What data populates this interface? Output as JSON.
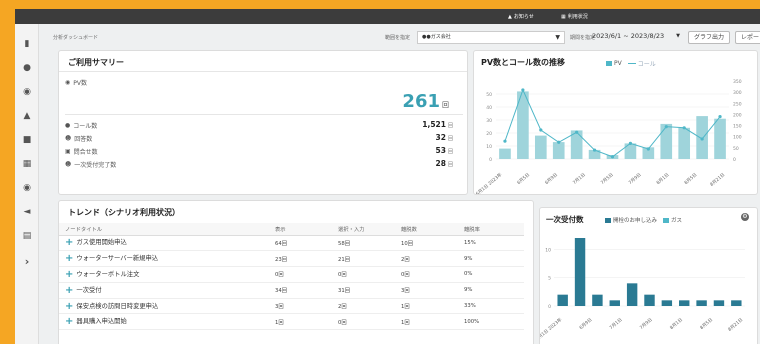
{
  "topbar": {
    "notice": "お知らせ",
    "usage": "利用状況"
  },
  "nav": [
    "analytics-icon",
    "chat-icon",
    "chat2-icon",
    "graduation-icon",
    "folder-icon",
    "calendar-icon",
    "location-icon",
    "megaphone-icon",
    "document-icon",
    "chevron-right-icon"
  ],
  "filter": {
    "breadcrumb": "分析ダッシュボード",
    "company_label": "範囲を指定",
    "company_value": "●●ガス会社",
    "date_label": "期間を指定",
    "date_value": "2023/6/1 ~ 2023/8/23",
    "graph_btn": "グラフ出力",
    "report_btn": "レポート出力"
  },
  "summary": {
    "title": "ご利用サマリー",
    "pv_label": "PV数",
    "pv_value": "261",
    "pv_unit": "回",
    "rows": [
      {
        "label": "コール数",
        "value": "1,521",
        "unit": "回"
      },
      {
        "label": "回答数",
        "value": "32",
        "unit": "回"
      },
      {
        "label": "問合せ数",
        "value": "53",
        "unit": "回"
      },
      {
        "label": "一次受付完了数",
        "value": "28",
        "unit": "回"
      }
    ]
  },
  "trend": {
    "title": "トレンド（シナリオ利用状況）",
    "headers": [
      "ノードタイトル",
      "表示",
      "選択・入力",
      "離脱数",
      "離脱率"
    ],
    "rows": [
      [
        "ガス使用開始申込",
        "64回",
        "58回",
        "10回",
        "15%"
      ],
      [
        "ウォーターサーバー新規申込",
        "23回",
        "21回",
        "2回",
        "9%"
      ],
      [
        "ウォーターボトル注文",
        "0回",
        "0回",
        "0回",
        "0%"
      ],
      [
        "一次受付",
        "34回",
        "31回",
        "3回",
        "9%"
      ],
      [
        "保安点検の訪問日時変更申込",
        "3回",
        "2回",
        "1回",
        "33%"
      ],
      [
        "器具購入申込開始",
        "1回",
        "0回",
        "1回",
        "100%"
      ]
    ]
  },
  "chart_data": [
    {
      "type": "bar",
      "title": "PV数とコール数の推移",
      "legend": [
        "PV",
        "コール"
      ],
      "categories": [
        "6月1日 2023年",
        "6月5日",
        "6月9日",
        "7月1日",
        "7月5日",
        "7月9日",
        "8月1日",
        "8月5日",
        "8月21日"
      ],
      "series": [
        {
          "name": "PV",
          "kind": "bar",
          "axis": "left",
          "values": [
            8,
            52,
            18,
            13,
            22,
            7,
            3,
            12,
            9,
            27,
            24,
            33,
            31
          ]
        },
        {
          "name": "コール",
          "kind": "line",
          "axis": "right",
          "values": [
            80,
            310,
            130,
            75,
            120,
            40,
            10,
            70,
            45,
            145,
            140,
            90,
            190
          ]
        }
      ],
      "ylim_left": [
        0,
        60
      ],
      "yticks_left": [
        0,
        10,
        20,
        30,
        40,
        50
      ],
      "ylim_right": [
        0,
        350
      ],
      "yticks_right": [
        0,
        50,
        100,
        150,
        200,
        250,
        300,
        350
      ],
      "colors": {
        "PV": "#9fd4db",
        "コール": "#4fb7c8"
      }
    },
    {
      "type": "bar",
      "title": "一次受付数",
      "legend": [
        "開栓のお申し込み",
        "ガス"
      ],
      "categories": [
        "6月1日 2023年",
        "6月9日",
        "7月1日",
        "7月9日",
        "8月1日",
        "8月5日",
        "8月21日"
      ],
      "series": [
        {
          "name": "開栓のお申し込み",
          "values": [
            2,
            12,
            2,
            1,
            4,
            2,
            1,
            1,
            1,
            1,
            1
          ]
        }
      ],
      "ylim": [
        0,
        12
      ],
      "yticks": [
        0,
        5,
        10
      ],
      "colors": {
        "開栓のお申し込み": "#2a7a93",
        "ガス": "#4fb7c8"
      }
    }
  ]
}
